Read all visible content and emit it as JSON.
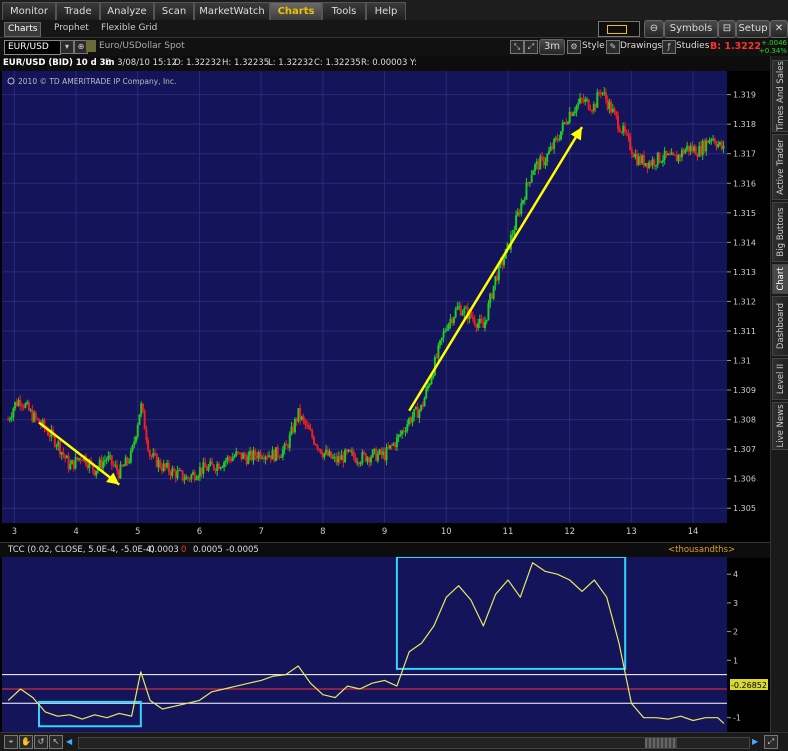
{
  "menu": {
    "tabs": [
      {
        "label": "Monitor",
        "active": false
      },
      {
        "label": "Trade",
        "active": false
      },
      {
        "label": "Analyze",
        "active": false
      },
      {
        "label": "Scan",
        "active": false
      },
      {
        "label": "MarketWatch",
        "active": false
      },
      {
        "label": "Charts",
        "active": true
      },
      {
        "label": "Tools",
        "active": false
      },
      {
        "label": "Help",
        "active": false
      }
    ],
    "symbols_label": "Symbols",
    "setup_label": "Setup"
  },
  "subtabs": [
    {
      "label": "Charts",
      "active": true
    },
    {
      "label": "Prophet",
      "active": false
    },
    {
      "label": "Flexible Grid",
      "active": false
    }
  ],
  "symbol_bar": {
    "symbol": "EUR/USD",
    "description": "Euro/USDollar Spot",
    "timeframe": "3m",
    "style_label": "Style",
    "drawings_label": "Drawings",
    "studies_label": "Studies",
    "bid_label": "B: 1.3222",
    "change_abs": "+.0046",
    "change_pct": "+0.34%"
  },
  "info_bar": {
    "symbol": "EUR/USD (BID) 10 d 3m",
    "date": "D: 3/08/10 15:12",
    "open": "O: 1.32232",
    "high": "H: 1.32235",
    "low": "L: 1.32232",
    "close": "C: 1.32235",
    "range": "R: 0.00003",
    "y": "Y:"
  },
  "copyright": "2010 © TD AMERITRADE IP Company, Inc.",
  "indicator": {
    "label": "TCC (0.02, CLOSE, 5.0E-4, -5.0E-4)",
    "value": "-0.0003",
    "zero": "0",
    "upper": "0.0005",
    "lower": "-0.0005",
    "units": "<thousandths>",
    "current_value": "-0.26852"
  },
  "right_tabs": [
    "Times And Sales",
    "Active Trader",
    "Big Buttons",
    "Chart",
    "Dashboard",
    "Level II",
    "Live News"
  ],
  "colors": {
    "panel_bg": "#14145a",
    "up_candle": "#22cc22",
    "down_candle": "#ee2020",
    "arrow": "#ffff00",
    "indicator_line": "#e8e860",
    "box": "#33d6ff",
    "ob_line": "#ffffff",
    "zero_line": "#ff3030",
    "accent": "#f0c000"
  },
  "chart_data": [
    {
      "type": "candlestick",
      "title": "EUR/USD (BID) 10 d 3m",
      "x_ticks": [
        "3",
        "4",
        "5",
        "6",
        "7",
        "8",
        "9",
        "10",
        "11",
        "12",
        "13",
        "14"
      ],
      "y_ticks": [
        "1.305",
        "1.306",
        "1.307",
        "1.308",
        "1.309",
        "1.31",
        "1.311",
        "1.312",
        "1.313",
        "1.314",
        "1.315",
        "1.316",
        "1.317",
        "1.318",
        "1.319"
      ],
      "ylim": [
        1.3045,
        1.3198
      ],
      "price_path": [
        {
          "x": 2.9,
          "y": 1.308
        },
        {
          "x": 3.0,
          "y": 1.3085
        },
        {
          "x": 3.1,
          "y": 1.3087
        },
        {
          "x": 3.3,
          "y": 1.3081
        },
        {
          "x": 3.5,
          "y": 1.3077
        },
        {
          "x": 3.7,
          "y": 1.3072
        },
        {
          "x": 3.9,
          "y": 1.3064
        },
        {
          "x": 4.1,
          "y": 1.3068
        },
        {
          "x": 4.3,
          "y": 1.3063
        },
        {
          "x": 4.5,
          "y": 1.3067
        },
        {
          "x": 4.7,
          "y": 1.3062
        },
        {
          "x": 4.9,
          "y": 1.3068
        },
        {
          "x": 5.05,
          "y": 1.3085
        },
        {
          "x": 5.2,
          "y": 1.3068
        },
        {
          "x": 5.4,
          "y": 1.3064
        },
        {
          "x": 5.6,
          "y": 1.3062
        },
        {
          "x": 5.8,
          "y": 1.306
        },
        {
          "x": 6.0,
          "y": 1.3063
        },
        {
          "x": 6.2,
          "y": 1.3064
        },
        {
          "x": 6.4,
          "y": 1.3066
        },
        {
          "x": 6.6,
          "y": 1.3068
        },
        {
          "x": 6.8,
          "y": 1.3067
        },
        {
          "x": 7.0,
          "y": 1.3069
        },
        {
          "x": 7.2,
          "y": 1.3068
        },
        {
          "x": 7.4,
          "y": 1.307
        },
        {
          "x": 7.6,
          "y": 1.3082
        },
        {
          "x": 7.8,
          "y": 1.3075
        },
        {
          "x": 8.0,
          "y": 1.3069
        },
        {
          "x": 8.2,
          "y": 1.3066
        },
        {
          "x": 8.4,
          "y": 1.3068
        },
        {
          "x": 8.6,
          "y": 1.3067
        },
        {
          "x": 8.8,
          "y": 1.3068
        },
        {
          "x": 9.0,
          "y": 1.3068
        },
        {
          "x": 9.2,
          "y": 1.3073
        },
        {
          "x": 9.4,
          "y": 1.308
        },
        {
          "x": 9.6,
          "y": 1.3084
        },
        {
          "x": 9.8,
          "y": 1.3098
        },
        {
          "x": 10.0,
          "y": 1.3112
        },
        {
          "x": 10.2,
          "y": 1.3118
        },
        {
          "x": 10.4,
          "y": 1.3115
        },
        {
          "x": 10.6,
          "y": 1.3111
        },
        {
          "x": 10.8,
          "y": 1.3128
        },
        {
          "x": 11.0,
          "y": 1.3138
        },
        {
          "x": 11.2,
          "y": 1.3152
        },
        {
          "x": 11.4,
          "y": 1.3165
        },
        {
          "x": 11.6,
          "y": 1.3168
        },
        {
          "x": 11.8,
          "y": 1.3175
        },
        {
          "x": 12.0,
          "y": 1.3184
        },
        {
          "x": 12.2,
          "y": 1.3188
        },
        {
          "x": 12.4,
          "y": 1.3186
        },
        {
          "x": 12.5,
          "y": 1.3192
        },
        {
          "x": 12.7,
          "y": 1.3184
        },
        {
          "x": 12.9,
          "y": 1.3176
        },
        {
          "x": 13.1,
          "y": 1.3168
        },
        {
          "x": 13.3,
          "y": 1.3167
        },
        {
          "x": 13.5,
          "y": 1.3169
        },
        {
          "x": 13.7,
          "y": 1.3168
        },
        {
          "x": 13.9,
          "y": 1.3172
        },
        {
          "x": 14.1,
          "y": 1.3171
        },
        {
          "x": 14.3,
          "y": 1.3176
        },
        {
          "x": 14.5,
          "y": 1.3171
        }
      ],
      "annotations": [
        {
          "type": "arrow",
          "from": {
            "x": 3.4,
            "y": 1.3079
          },
          "to": {
            "x": 4.7,
            "y": 1.3058
          }
        },
        {
          "type": "arrow",
          "from": {
            "x": 9.4,
            "y": 1.3083
          },
          "to": {
            "x": 12.2,
            "y": 1.3179
          }
        }
      ]
    },
    {
      "type": "line",
      "title": "TCC (0.02, CLOSE, 5.0E-4, -5.0E-4)",
      "y_ticks": [
        "-1",
        "1",
        "2",
        "3",
        "4"
      ],
      "ylim": [
        -1.5,
        4.6
      ],
      "levels": {
        "upper": 0.5,
        "zero": 0,
        "lower": -0.5
      },
      "series": [
        {
          "values": [
            {
              "x": 2.9,
              "y": -0.4
            },
            {
              "x": 3.1,
              "y": 0.0
            },
            {
              "x": 3.3,
              "y": -0.3
            },
            {
              "x": 3.5,
              "y": -0.8
            },
            {
              "x": 3.7,
              "y": -0.95
            },
            {
              "x": 3.9,
              "y": -0.9
            },
            {
              "x": 4.1,
              "y": -1.05
            },
            {
              "x": 4.3,
              "y": -0.9
            },
            {
              "x": 4.5,
              "y": -1.0
            },
            {
              "x": 4.7,
              "y": -0.85
            },
            {
              "x": 4.9,
              "y": -0.95
            },
            {
              "x": 5.05,
              "y": 0.6
            },
            {
              "x": 5.2,
              "y": -0.4
            },
            {
              "x": 5.4,
              "y": -0.7
            },
            {
              "x": 5.6,
              "y": -0.6
            },
            {
              "x": 5.8,
              "y": -0.5
            },
            {
              "x": 6.0,
              "y": -0.4
            },
            {
              "x": 6.2,
              "y": -0.1
            },
            {
              "x": 6.4,
              "y": 0.0
            },
            {
              "x": 6.6,
              "y": 0.1
            },
            {
              "x": 6.8,
              "y": 0.2
            },
            {
              "x": 7.0,
              "y": 0.3
            },
            {
              "x": 7.2,
              "y": 0.45
            },
            {
              "x": 7.4,
              "y": 0.5
            },
            {
              "x": 7.6,
              "y": 0.8
            },
            {
              "x": 7.8,
              "y": 0.2
            },
            {
              "x": 8.0,
              "y": -0.2
            },
            {
              "x": 8.2,
              "y": -0.3
            },
            {
              "x": 8.4,
              "y": 0.1
            },
            {
              "x": 8.6,
              "y": 0.0
            },
            {
              "x": 8.8,
              "y": 0.2
            },
            {
              "x": 9.0,
              "y": 0.3
            },
            {
              "x": 9.2,
              "y": 0.1
            },
            {
              "x": 9.4,
              "y": 1.3
            },
            {
              "x": 9.6,
              "y": 1.6
            },
            {
              "x": 9.8,
              "y": 2.2
            },
            {
              "x": 10.0,
              "y": 3.2
            },
            {
              "x": 10.2,
              "y": 3.6
            },
            {
              "x": 10.4,
              "y": 3.1
            },
            {
              "x": 10.6,
              "y": 2.2
            },
            {
              "x": 10.8,
              "y": 3.3
            },
            {
              "x": 11.0,
              "y": 3.8
            },
            {
              "x": 11.2,
              "y": 3.2
            },
            {
              "x": 11.4,
              "y": 4.4
            },
            {
              "x": 11.6,
              "y": 4.1
            },
            {
              "x": 11.8,
              "y": 4.0
            },
            {
              "x": 12.0,
              "y": 3.8
            },
            {
              "x": 12.2,
              "y": 3.4
            },
            {
              "x": 12.4,
              "y": 3.8
            },
            {
              "x": 12.6,
              "y": 3.2
            },
            {
              "x": 12.8,
              "y": 1.6
            },
            {
              "x": 13.0,
              "y": -0.5
            },
            {
              "x": 13.2,
              "y": -1.0
            },
            {
              "x": 13.4,
              "y": -1.0
            },
            {
              "x": 13.6,
              "y": -1.05
            },
            {
              "x": 13.8,
              "y": -0.95
            },
            {
              "x": 14.0,
              "y": -1.1
            },
            {
              "x": 14.2,
              "y": -1.0
            },
            {
              "x": 14.4,
              "y": -1.0
            },
            {
              "x": 14.5,
              "y": -1.2
            }
          ]
        }
      ],
      "annotations": [
        {
          "type": "box",
          "x": [
            3.4,
            5.05
          ],
          "y": [
            -1.3,
            -0.45
          ]
        },
        {
          "type": "box",
          "x": [
            9.2,
            12.9
          ],
          "y": [
            0.7,
            4.6
          ]
        }
      ]
    }
  ]
}
